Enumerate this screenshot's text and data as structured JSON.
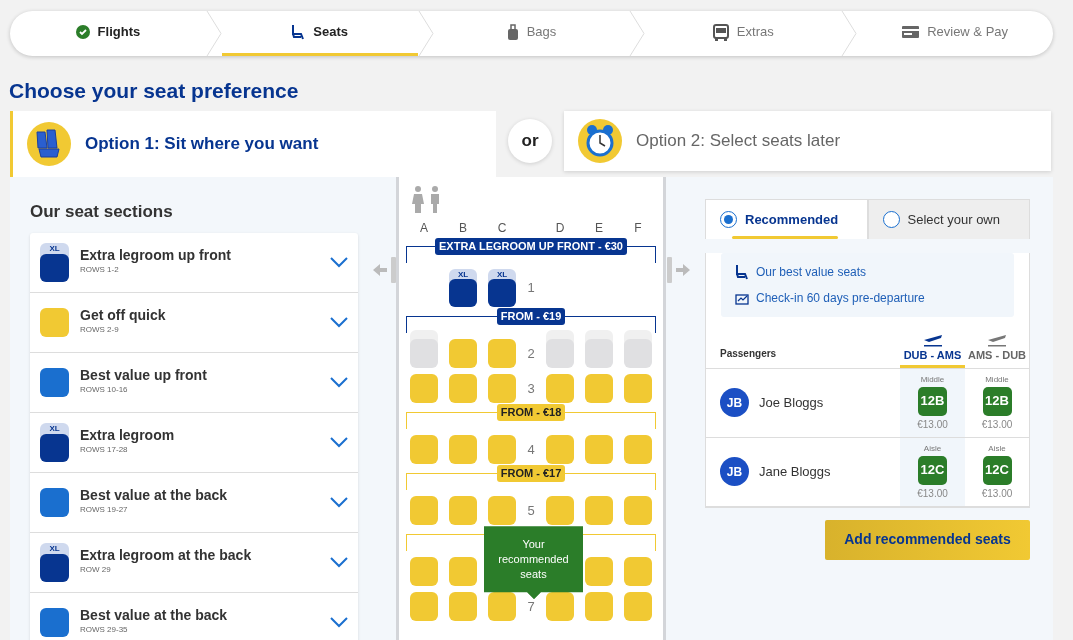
{
  "steps": [
    {
      "label": "Flights",
      "completed": true,
      "selected": false
    },
    {
      "label": "Seats",
      "completed": false,
      "selected": true
    },
    {
      "label": "Bags",
      "completed": false,
      "selected": false
    },
    {
      "label": "Extras",
      "completed": false,
      "selected": false
    },
    {
      "label": "Review & Pay",
      "completed": false,
      "selected": false
    }
  ],
  "title": "Choose your seat preference",
  "options": [
    {
      "label": "Option 1: Sit where you want",
      "selected": true
    },
    {
      "label": "Option 2: Select seats later",
      "selected": false
    }
  ],
  "options_separator": "or",
  "sections_title": "Our seat sections",
  "sections": [
    {
      "name": "Extra legroom up front",
      "rows": "ROWS 1-2",
      "color": "#073590",
      "badge": "XL"
    },
    {
      "name": "Get off quick",
      "rows": "ROWS 2-9",
      "color": "#f1c933"
    },
    {
      "name": "Best value up front",
      "rows": "ROWS 10-16",
      "color": "#1a6fcf"
    },
    {
      "name": "Extra legroom",
      "rows": "ROWS 17-28",
      "color": "#073590",
      "badge": "XL"
    },
    {
      "name": "Best value at the back",
      "rows": "ROWS 19-27",
      "color": "#1a6fcf"
    },
    {
      "name": "Extra legroom at the back",
      "rows": "ROW 29",
      "color": "#073590",
      "badge": "XL"
    },
    {
      "name": "Best value at the back",
      "rows": "ROWS 29-35",
      "color": "#1a6fcf"
    }
  ],
  "seat_map": {
    "columns": [
      "A",
      "B",
      "C",
      "D",
      "E",
      "F"
    ],
    "items": [
      {
        "kind": "banner",
        "text": "EXTRA LEGROOM UP FRONT - €30",
        "color": "#073590"
      },
      {
        "kind": "row",
        "number": "1",
        "seats": [
          {
            "kind": "empty"
          },
          {
            "kind": "xl",
            "label": "XL"
          },
          {
            "kind": "xl",
            "label": "XL"
          },
          {
            "kind": "empty"
          },
          {
            "kind": "empty"
          },
          {
            "kind": "empty"
          }
        ]
      },
      {
        "kind": "banner",
        "text": "FROM - €19",
        "color": "#073590"
      },
      {
        "kind": "row",
        "number": "2",
        "seats": [
          {
            "kind": "unavailable"
          },
          {
            "kind": "standard"
          },
          {
            "kind": "standard"
          },
          {
            "kind": "unavailable"
          },
          {
            "kind": "unavailable"
          },
          {
            "kind": "unavailable"
          }
        ]
      },
      {
        "kind": "row",
        "number": "3",
        "seats": [
          {
            "kind": "standard"
          },
          {
            "kind": "standard"
          },
          {
            "kind": "standard"
          },
          {
            "kind": "standard"
          },
          {
            "kind": "standard"
          },
          {
            "kind": "standard"
          }
        ]
      },
      {
        "kind": "banner",
        "text": "FROM - €18",
        "color": "#f1c933"
      },
      {
        "kind": "row",
        "number": "4",
        "seats": [
          {
            "kind": "standard"
          },
          {
            "kind": "standard"
          },
          {
            "kind": "standard"
          },
          {
            "kind": "standard"
          },
          {
            "kind": "standard"
          },
          {
            "kind": "standard"
          }
        ]
      },
      {
        "kind": "banner",
        "text": "FROM - €17",
        "color": "#f1c933"
      },
      {
        "kind": "row",
        "number": "5",
        "seats": [
          {
            "kind": "standard"
          },
          {
            "kind": "standard"
          },
          {
            "kind": "standard"
          },
          {
            "kind": "standard"
          },
          {
            "kind": "standard"
          },
          {
            "kind": "standard"
          }
        ]
      },
      {
        "kind": "banner",
        "color": "#f1c933"
      },
      {
        "kind": "row",
        "seats": [
          {
            "kind": "standard"
          },
          {
            "kind": "standard"
          },
          {
            "kind": "covered"
          },
          {
            "kind": "covered"
          },
          {
            "kind": "standard"
          },
          {
            "kind": "standard"
          }
        ]
      },
      {
        "kind": "row",
        "number": "7",
        "seats": [
          {
            "kind": "standard"
          },
          {
            "kind": "standard"
          },
          {
            "kind": "standard"
          },
          {
            "kind": "standard"
          },
          {
            "kind": "standard"
          },
          {
            "kind": "standard"
          }
        ]
      }
    ],
    "tooltip": "Your recommended seats"
  },
  "seat_tabs": [
    {
      "label": "Recommended",
      "selected": true
    },
    {
      "label": "Select your own",
      "selected": false
    }
  ],
  "benefits": [
    "Our best value seats",
    "Check-in 60 days pre-departure"
  ],
  "passengers_heading": "Passengers",
  "flights": [
    {
      "route": "DUB - AMS",
      "selected": true
    },
    {
      "route": "AMS - DUB",
      "selected": false
    }
  ],
  "passengers": [
    {
      "initials": "JB",
      "name": "Joe Bloggs",
      "seats": [
        {
          "position": "Middle",
          "seat": "12B",
          "price": "€13.00"
        },
        {
          "position": "Middle",
          "seat": "12B",
          "price": "€13.00"
        }
      ]
    },
    {
      "initials": "JB",
      "name": "Jane Bloggs",
      "seats": [
        {
          "position": "Aisle",
          "seat": "12C",
          "price": "€13.00"
        },
        {
          "position": "Aisle",
          "seat": "12C",
          "price": "€13.00"
        }
      ]
    }
  ],
  "add_button": "Add recommended seats"
}
